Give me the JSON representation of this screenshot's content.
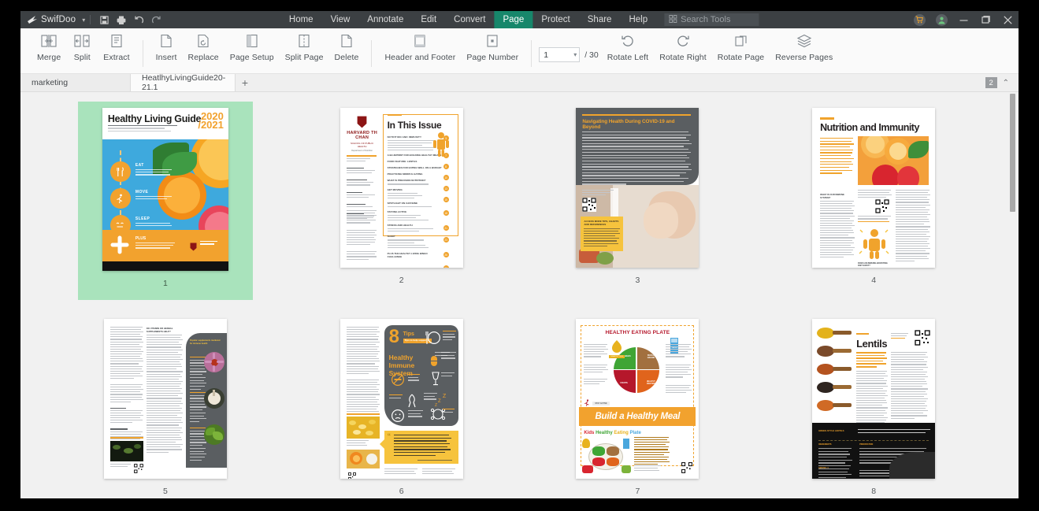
{
  "app": {
    "name": "SwifDoo",
    "window_controls": [
      "minimize",
      "maximize",
      "close"
    ],
    "quick_access": [
      "save-icon",
      "print-icon",
      "undo-icon",
      "redo-icon"
    ],
    "cart_icon": "cart-icon",
    "account_icon": "user-avatar-icon"
  },
  "menu": {
    "items": [
      {
        "label": "Home",
        "active": false
      },
      {
        "label": "View",
        "active": false
      },
      {
        "label": "Annotate",
        "active": false
      },
      {
        "label": "Edit",
        "active": false
      },
      {
        "label": "Convert",
        "active": false
      },
      {
        "label": "Page",
        "active": true
      },
      {
        "label": "Protect",
        "active": false
      },
      {
        "label": "Share",
        "active": false
      },
      {
        "label": "Help",
        "active": false
      }
    ],
    "active_color": "#17876b",
    "search": {
      "placeholder": "Search Tools",
      "icon": "search-tools-icon"
    }
  },
  "ribbon": {
    "groups": [
      {
        "buttons": [
          {
            "label": "Merge",
            "icon": "merge-icon"
          },
          {
            "label": "Split",
            "icon": "split-icon"
          },
          {
            "label": "Extract",
            "icon": "extract-icon"
          }
        ]
      },
      {
        "buttons": [
          {
            "label": "Insert",
            "icon": "insert-page-icon"
          },
          {
            "label": "Replace",
            "icon": "replace-page-icon"
          },
          {
            "label": "Page Setup",
            "icon": "page-setup-icon"
          },
          {
            "label": "Split Page",
            "icon": "split-page-icon"
          },
          {
            "label": "Delete",
            "icon": "delete-page-icon"
          }
        ]
      },
      {
        "buttons": [
          {
            "label": "Header and Footer",
            "icon": "header-footer-icon"
          },
          {
            "label": "Page Number",
            "icon": "page-number-icon"
          }
        ]
      },
      {
        "buttons": [
          {
            "label": "Rotate Left",
            "icon": "rotate-left-icon"
          },
          {
            "label": "Rotate Right",
            "icon": "rotate-right-icon"
          },
          {
            "label": "Rotate Page",
            "icon": "rotate-page-icon"
          },
          {
            "label": "Reverse Pages",
            "icon": "reverse-pages-icon"
          }
        ]
      }
    ],
    "page_selector": {
      "value": "1",
      "total": "/ 30",
      "dropdown_icon": "chevron-down-icon"
    }
  },
  "doc_tabs": {
    "tabs": [
      {
        "label": "marketing",
        "active": false,
        "modified": false
      },
      {
        "label": "HeatlhyLivingGuide20-21.1",
        "active": true,
        "modified": true
      }
    ],
    "new_tab_label": "+",
    "count_badge": "2",
    "collapse_icon": "chevron-up-icon"
  },
  "thumbnails": {
    "selected_page": 1,
    "pages": [
      {
        "number": "1",
        "kind": "cover",
        "title": "Healthy Living Guide",
        "year": "2020\n/2021",
        "subtitle": "A DIGEST ON HEALTHY EATING AND HEALTHY LIVING",
        "sections": [
          {
            "label": "EAT",
            "icon": "fork-knife-icon",
            "line1": "Does an immune-boosting diet exist?",
            "line2": "Strategies for eating on a budget",
            "line3": "Understanding precision nutrition"
          },
          {
            "label": "MOVE",
            "icon": "runner-icon",
            "line1": "Evidence for staying active",
            "line2": "Do we need 10,000 steps per day?"
          },
          {
            "label": "SLEEP",
            "icon": "sleep-face-icon",
            "line1": "How much sleep do we need?",
            "line2": "Tips for getting a good night's rest"
          },
          {
            "label": "PLUS",
            "icon": "plus-icon",
            "line1": "Understanding the impact of stress",
            "line2": "on eating patterns and health, and",
            "line3": "strategies that may help confront it"
          }
        ],
        "publisher": "HARVARD T.H. CHAN SCHOOL OF PUBLIC HEALTH"
      },
      {
        "number": "2",
        "kind": "contents",
        "heading": "In This Issue",
        "logo": "HARVARD TH CHAN",
        "logo_sub": "SCHOOL OF PUBLIC HEALTH",
        "logo_dept": "Department of Nutrition",
        "sidebar_heading": "HEALTHY LIVING GUIDE EDITORIAL TEAM",
        "entries": [
          {
            "title": "NUTRITION AND IMMUNITY",
            "page": "3",
            "bullets": [
              "Understanding the body's immune system",
              "Does an immune-boosting diet exist?",
              "The role of the microbiome",
              "A closer look at vitamin and herbal supplements",
              "8 tips to support a healthy immune system"
            ]
          },
          {
            "title": "A BLUEPRINT FOR BUILDING HEALTHY MEALS",
            "page": "7"
          },
          {
            "title": "FOOD FEATURE: LENTILS",
            "page": "8"
          },
          {
            "title": "STRATEGIES FOR EATING WELL ON A BUDGET",
            "page": "10"
          },
          {
            "title": "PRACTICING MINDFUL EATING",
            "page": "13"
          },
          {
            "title": "WHAT IS PRECISION NUTRITION?",
            "page": "15",
            "bullets": [
              "Understanding the emerging research area"
            ]
          },
          {
            "title": "GET MOVING",
            "page": "18",
            "bullets": [
              "Using your Fitbit",
              "Intermittent eating",
              "Quick start"
            ]
          },
          {
            "title": "SPOTLIGHT ON CAFFEINE",
            "page": "21",
            "bullets": [
              "Sources of caffeine and how much is too much"
            ]
          },
          {
            "title": "STAYING ACTIVE",
            "page": "23",
            "bullets": [
              "10 tips to keep moving",
              "Real-talk safety",
              "Spotlight on walking for exercise"
            ]
          },
          {
            "title": "STRESS AND HEALTH",
            "page": "26",
            "bullets": [
              "How does chronic stress affect eating patterns?",
              "Ways to help control stress"
            ]
          },
          {
            "title": "SLEEP",
            "page": "28",
            "bullets": [
              "How much sleep do we need?",
              "Why do we sleep?",
              "Eating and sleep: any link?",
              "Tips for getting a good night's rest"
            ]
          },
          {
            "title": "PLUS THE HEALTHY LIVING BINGO CHALLENGE",
            "page": "30"
          }
        ]
      },
      {
        "number": "3",
        "kind": "article-dark",
        "heading": "Navigating Health During COVID-19 and Beyond",
        "photo_alt": "hands being washed under running tap",
        "callout_heading": "ACCESS MORE TIPS, CHARTS AND REFERENCES",
        "qr": "qr-code"
      },
      {
        "number": "4",
        "kind": "article-photo",
        "heading": "Nutrition and Immunity",
        "photo_alt": "sliced oranges and strawberries",
        "sub_heading": "WHAT IS OUR IMMUNE SYSTEM?",
        "sub_heading_2": "DOES AN IMMUNE-BOOSTING DIET EXIST?",
        "figure": "immune-person-icon",
        "qr": "qr-code"
      },
      {
        "number": "5",
        "kind": "article-sidebar",
        "heading": "DO VITAMIN OR HERBAL SUPPLEMENTS HELP?",
        "sidebar_heading": "Popular supplements marketed for immune health",
        "bullets": [
          "Probiotic foods",
          "Prebiotic foods"
        ],
        "circle_photos": [
          "echinacea-flower",
          "garlic-bulb",
          "kale-leaves"
        ],
        "qr": "qr-code"
      },
      {
        "number": "6",
        "kind": "tips",
        "big_number": "8",
        "heading_small": "Tips to help support a",
        "heading": "Healthy Immune System",
        "tips_icons": [
          "plate-utensils-icon",
          "supplement-pill-icon",
          "no-smoking-icon",
          "wine-glass-icon",
          "ribbon-icon",
          "sleep-zzz-icon",
          "stress-face-icon",
          "hygiene-icon"
        ],
        "quote": "We have known for a long time that nutrition is intricately linked to immunity and to the risk and severity of infections.",
        "qr": "qr-code"
      },
      {
        "number": "7",
        "kind": "plate",
        "heading": "HEALTHY EATING PLATE",
        "banner": "Build a Healthy Meal",
        "sub_heading": "Kids Healthy Eating Plate",
        "plate_segments": [
          {
            "label": "VEGETABLES",
            "color": "#3fa535"
          },
          {
            "label": "WHOLE GRAINS",
            "color": "#a2703f"
          },
          {
            "label": "FRUITS",
            "color": "#b5172b"
          },
          {
            "label": "HEALTHY PROTEIN",
            "color": "#e0641c"
          }
        ],
        "extras": [
          {
            "label": "HEALTHY OILS",
            "color": "#e8b21e"
          },
          {
            "label": "WATER",
            "color": "#4aa7dd"
          },
          {
            "label": "STAY ACTIVE",
            "color": "#b5172b"
          }
        ],
        "qr": "qr-code"
      },
      {
        "number": "8",
        "kind": "lentils",
        "heading": "Lentils",
        "deck": "Lentils are one of the earliest domesticated crops, rooted in the diets of ancient Rome and Egypt. Learn about this staple legume.",
        "recipe_heading": "GREEK-STYLE LENTILS",
        "recipe_cols": [
          "INGREDIENTS",
          "PREPARATION"
        ],
        "serves": "SERVES: 4",
        "spoon_colors": [
          "#e3b21c",
          "#7a4a2a",
          "#b4531f",
          "#2f2520",
          "#d06a25"
        ],
        "qr": "qr-code"
      }
    ]
  },
  "scrollbar": {
    "orientation": "vertical",
    "position_pct": 0
  }
}
